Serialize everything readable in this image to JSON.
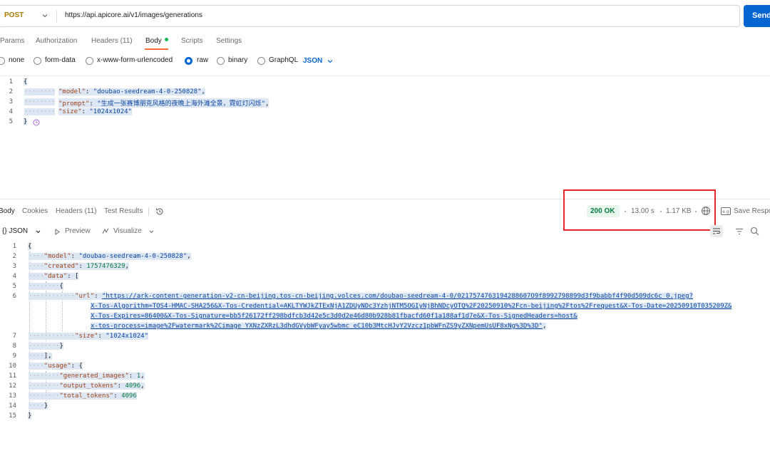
{
  "request": {
    "method": "POST",
    "url": "https://api.apicore.ai/v1/images/generations",
    "send_label": "Send"
  },
  "request_tabs": [
    "Params",
    "Authorization",
    "Headers (11)",
    "Body",
    "Scripts",
    "Settings"
  ],
  "body_types": {
    "options": [
      "none",
      "form-data",
      "x-www-form-urlencoded",
      "raw",
      "binary",
      "GraphQL"
    ],
    "selected": "raw",
    "format": "JSON"
  },
  "request_body": {
    "line_numbers": [
      "1",
      "2",
      "3",
      "4",
      "5"
    ],
    "open_brace": "{",
    "model_key": "\"model\"",
    "model_value": "\"doubao-seedream-4-0-250828\"",
    "prompt_key": "\"prompt\"",
    "prompt_value": "\"生成一张赛博朋克风格的夜晚上海外滩全景，霓虹灯闪烁\"",
    "size_key": "\"size\"",
    "size_value": "\"1024x1024\"",
    "close_brace": "}"
  },
  "response_tabs": [
    "Body",
    "Cookies",
    "Headers (11)",
    "Test Results"
  ],
  "response_meta": {
    "status": "200 OK",
    "time": "13.00 s",
    "size": "1.17 KB",
    "save_label": "Save Respo"
  },
  "response_view": {
    "format": "{} JSON",
    "preview": "Preview",
    "visualize": "Visualize"
  },
  "response_body": {
    "line_numbers": [
      "1",
      "2",
      "3",
      "4",
      "5",
      "6",
      "7",
      "8",
      "9",
      "10",
      "11",
      "12",
      "13",
      "14",
      "15"
    ],
    "model_key": "\"model\"",
    "model_value": "\"doubao-seedream-4-0-250828\"",
    "created_key": "\"created\"",
    "created_value": "1757476329",
    "data_key": "\"data\"",
    "url_key": "\"url\"",
    "url_line1": "\"https://ark-content-generation-v2-cn-beijing.tos-cn-beijing.volces.com/doubao-seedream-4-0/0217574763194288607O9f8992798899d3f9babbf4f90d509dc6c_0.jpeg?",
    "url_line2": "X-Tos-Algorithm=TOS4-HMAC-SHA256&X-Tos-Credential=AKLTYWJkZTExNjA1ZDUyNDc3YzhjNTM5OGIyNjBhNDcyOTQ%2F20250910%2Fcn-beijing%2Ftos%2Frequest&X-Tos-Date=20250910T035209Z&",
    "url_line3": "X-Tos-Expires=86400&X-Tos-Signature=bb5f26172ff298bdfcb3d42e5c3d0d2e46d80b928b81fbacfd60f1a188af1d7e&X-Tos-SignedHeaders=host&",
    "url_line4": "x-tos-process=image%2Fwatermark%2Cimage_YXNzZXRzL3dhdGVybWFyay5wbmc_eC10b3MtcHJvY2Vzcz1pbWFnZS9yZXNpemUsUF8xNg%3D%3D\"",
    "size_key": "\"size\"",
    "size_value": "\"1024x1024\"",
    "usage_key": "\"usage\"",
    "generated_key": "\"generated_images\"",
    "generated_value": "1",
    "output_key": "\"output_tokens\"",
    "output_value": "4096",
    "total_key": "\"total_tokens\"",
    "total_value": "4096"
  },
  "colors": {
    "accent": "#0265d2",
    "tab_indicator": "#ff6c37",
    "status_ok": "#0a7a41",
    "highlight_box": "#e8262a"
  },
  "icons": [
    "chevron-down-icon",
    "history-icon",
    "globe-icon",
    "save-icon",
    "wrap-lines-icon",
    "filter-icon",
    "search-icon",
    "preview-play-icon",
    "visualize-icon",
    "fold-icon"
  ]
}
